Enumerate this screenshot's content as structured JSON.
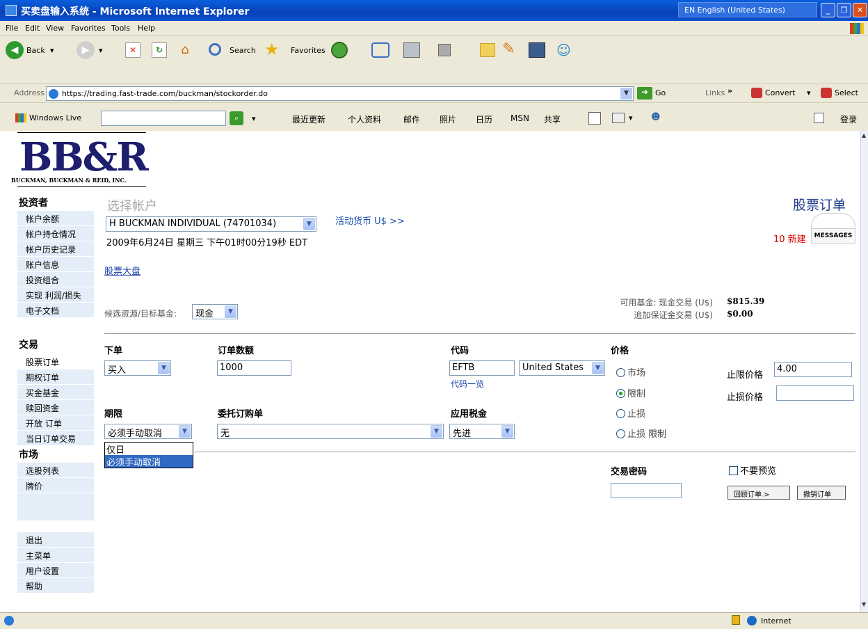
{
  "window": {
    "title": "买卖盘输入系统 - Microsoft Internet Explorer",
    "language": "EN English (United States)",
    "minimize": "_",
    "restore": "❐",
    "close": "✕"
  },
  "menu": [
    "File",
    "Edit",
    "View",
    "Favorites",
    "Tools",
    "Help"
  ],
  "toolbar": {
    "back": "Back",
    "search": "Search",
    "favorites": "Favorites"
  },
  "address": {
    "label": "Address",
    "url": "https://trading.fast-trade.com/buckman/stockorder.do",
    "go": "Go",
    "links": "Links",
    "more": "»",
    "convert": "Convert",
    "select": "Select"
  },
  "live": {
    "brand": "Windows Live",
    "links": [
      "最近更新",
      "个人资料",
      "邮件",
      "照片",
      "日历",
      "MSN",
      "共享"
    ],
    "login": "登录"
  },
  "logo": {
    "name": "BB&R",
    "subtitle": "BUCKMAN, BUCKMAN & REID, INC."
  },
  "sidebar": {
    "investor_head": "投资者",
    "investor": [
      "帐户余额",
      "帐户持仓情况",
      "帐户历史记录",
      "账户信息",
      "投资组合",
      "实现 利润/损失",
      "电子文档"
    ],
    "trade_head": "交易",
    "trade": [
      "股票订单",
      "期权订单",
      "买金基金",
      "赎回资金",
      "开放 订单",
      "当日订单交易"
    ],
    "market_head": "市场",
    "market": [
      "选股列表",
      "牌价"
    ],
    "other": [
      "退出",
      "主菜单",
      "用户设置",
      "帮助"
    ]
  },
  "main": {
    "select_account": "选择帐户",
    "account": "H BUCKMAN INDIVIDUAL (74701034)",
    "currency_link": "活动货币 U$ >>",
    "datetime": "2009年6月24日 星期三 下午01时00分19秒 EDT",
    "stock_board": "股票大盘",
    "page_title": "股票订单",
    "new_messages": "10 新建",
    "messages": "MESSAGES",
    "fund_source_label": "候选资源/目标基金:",
    "fund_source": "现金",
    "avail_cash_label": "可用基金: 现金交易 (U$)",
    "avail_cash": "$815.39",
    "margin_label": "追加保证金交易 (U$)",
    "margin": "$0.00",
    "order_label": "下单",
    "order_value": "买入",
    "qty_label": "订单数额",
    "qty_value": "1000",
    "symbol_label": "代码",
    "symbol_value": "EFTB",
    "market_value": "United States",
    "symbol_list": "代码一览",
    "price_label": "价格",
    "price_types": [
      "市场",
      "限制",
      "止损",
      "止损 限制"
    ],
    "limit_label": "止限价格",
    "limit_value": "4.00",
    "stop_label": "止损价格",
    "stop_value": "",
    "term_label": "期限",
    "term_value": "必须手动取消",
    "term_options": [
      "仅日",
      "必须手动取消"
    ],
    "proxy_label": "委托订购单",
    "proxy_value": "无",
    "tax_label": "应用税金",
    "tax_value": "先进",
    "password_label": "交易密码",
    "no_preview": "不要预览",
    "review_button": "回顾订单 >",
    "cancel_button": "撤销订单"
  },
  "status": {
    "zone": "Internet"
  }
}
